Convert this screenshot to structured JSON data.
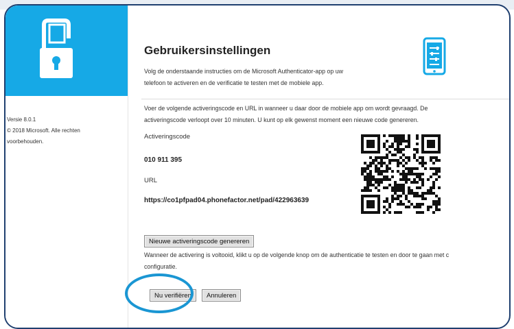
{
  "sidebar": {
    "version": "Versie 8.0.1",
    "copyright_line1": "© 2018 Microsoft. Alle rechten",
    "copyright_line2": "voorbehouden."
  },
  "header": {
    "title": "Gebruikersinstellingen",
    "intro_line1": "Volg de onderstaande instructies om de Microsoft Authenticator-app op uw",
    "intro_line2": "telefoon te activeren en de verificatie te testen met de mobiele app."
  },
  "activation": {
    "instruction_line1": "Voer de volgende activeringscode en URL in wanneer u daar door de mobiele app om wordt gevraagd. De",
    "instruction_line2": "activeringscode verloopt over 10 minuten. U kunt op elk gewenst moment een nieuwe code genereren.",
    "code_label": "Activeringscode",
    "code_value": "010 911 395",
    "url_label": "URL",
    "url_value": "https://co1pfpad04.phonefactor.net/pad/422963639",
    "new_code_button": "Nieuwe activeringscode genereren"
  },
  "completion": {
    "line1": "Wanneer de activering is voltooid, klikt u op de volgende knop om de authenticatie te testen en door te gaan met c",
    "line2": "configuratie."
  },
  "actions": {
    "verify_button": "Nu verifiëren",
    "cancel_button": "Annuleren"
  },
  "colors": {
    "brand_blue": "#16a9e6",
    "highlight_ring": "#1a96d3",
    "frame_border": "#1f3f6f"
  },
  "icons": {
    "logo": "lock-phone-logo-icon",
    "phone": "phone-settings-icon",
    "qr": "qr-code"
  }
}
